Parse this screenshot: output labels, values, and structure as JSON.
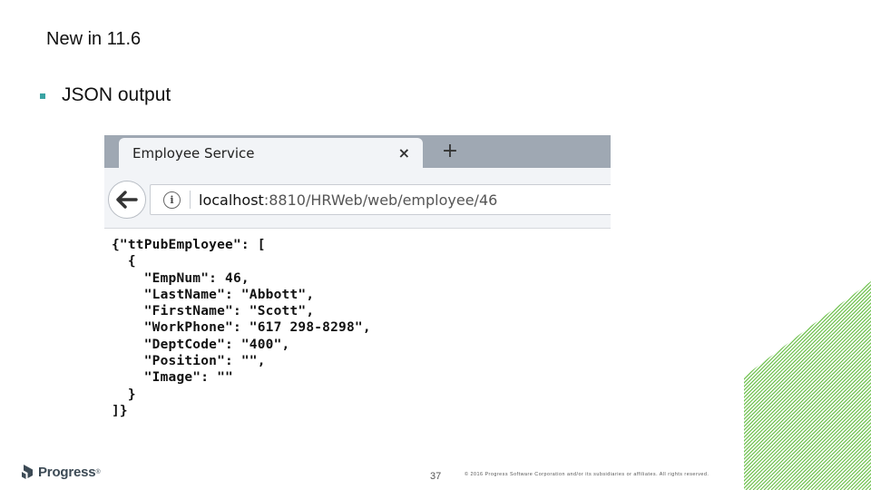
{
  "slide": {
    "title": "New in 11.6",
    "bullet": "JSON output",
    "page_number": "37",
    "copyright": "© 2016 Progress Software Corporation and/or its subsidiaries or affiliates. All rights reserved.",
    "logo_text": "Progress",
    "logo_mark": "®",
    "accent_color": "#3aa3a3",
    "hatch_color": "#6cc04a"
  },
  "browser": {
    "tab_title": "Employee Service",
    "tab_close": "×",
    "new_tab": "+",
    "url_host": "localhost",
    "url_path": ":8810/HRWeb/web/employee/46",
    "info_icon": "i",
    "back_icon": "back-arrow-icon"
  },
  "json_lines": [
    "{\"ttPubEmployee\": [",
    "  {",
    "    \"EmpNum\": 46,",
    "    \"LastName\": \"Abbott\",",
    "    \"FirstName\": \"Scott\",",
    "    \"WorkPhone\": \"617 298-8298\",",
    "    \"DeptCode\": \"400\",",
    "    \"Position\": \"\",",
    "    \"Image\": \"\"",
    "  }",
    "]}"
  ]
}
